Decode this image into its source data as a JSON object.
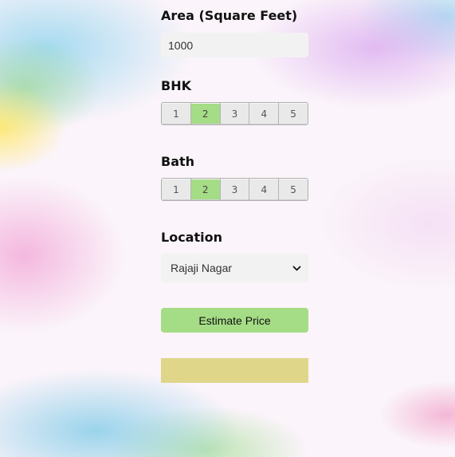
{
  "area": {
    "label": "Area (Square Feet)",
    "value": "1000"
  },
  "bhk": {
    "label": "BHK",
    "options": [
      "1",
      "2",
      "3",
      "4",
      "5"
    ],
    "selected": "2"
  },
  "bath": {
    "label": "Bath",
    "options": [
      "1",
      "2",
      "3",
      "4",
      "5"
    ],
    "selected": "2"
  },
  "location": {
    "label": "Location",
    "selected": "Rajaji Nagar",
    "icon": "chevron-down-icon"
  },
  "estimate": {
    "label": "Estimate Price"
  },
  "result": {
    "text": ""
  },
  "colors": {
    "accent_green": "#a5dc86",
    "result_yellow": "#dfd68a",
    "input_bg": "#f2f2f2"
  }
}
